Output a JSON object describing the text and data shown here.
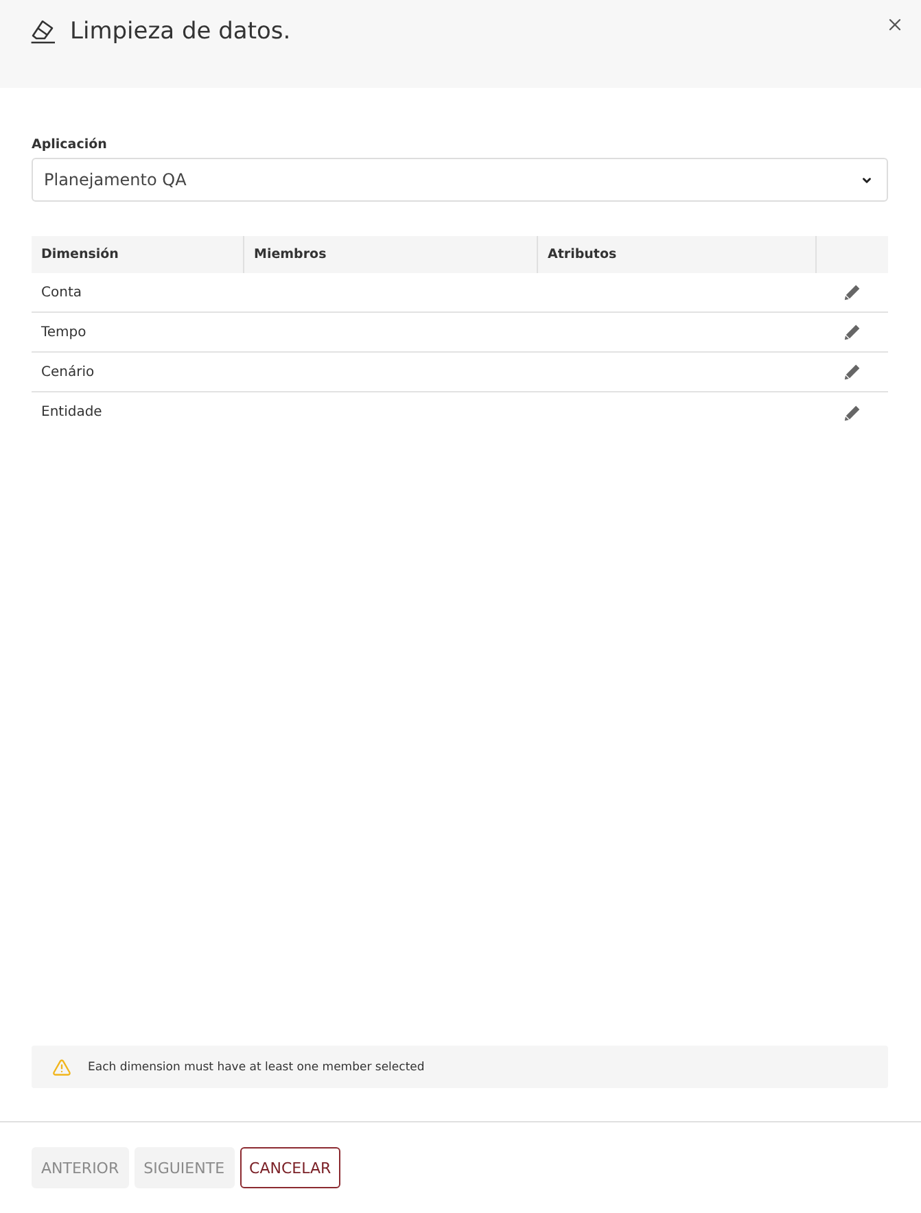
{
  "dialog": {
    "title": "Limpieza de datos."
  },
  "application": {
    "label": "Aplicación",
    "value": "Planejamento QA"
  },
  "table": {
    "columns": [
      "Dimensión",
      "Miembros",
      "Atributos"
    ],
    "rows": [
      {
        "dimension": "Conta"
      },
      {
        "dimension": "Tempo"
      },
      {
        "dimension": "Cenário"
      },
      {
        "dimension": "Entidade"
      }
    ]
  },
  "warning": {
    "message": "Each dimension must have at least one member selected"
  },
  "buttons": [
    {
      "label": "ANTERIOR",
      "disabled": true
    },
    {
      "label": "SIGUIENTE",
      "disabled": true
    },
    {
      "label": "CANCELAR",
      "disabled": false
    }
  ]
}
